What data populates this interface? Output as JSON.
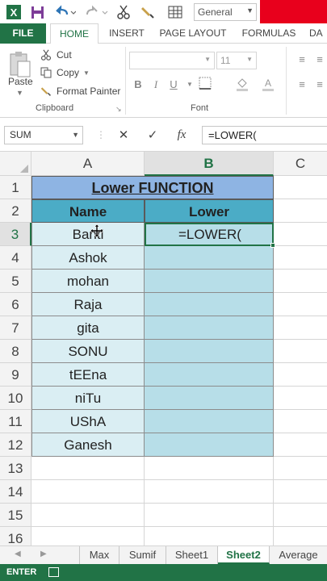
{
  "toolbar": {
    "number_format": "General",
    "icons": [
      "excel-logo-icon",
      "save-icon",
      "undo-icon",
      "redo-icon",
      "cut-icon",
      "format-painter-icon",
      "table-icon"
    ]
  },
  "ribbon": {
    "tabs": [
      {
        "label": "FILE"
      },
      {
        "label": "HOME"
      },
      {
        "label": "INSERT"
      },
      {
        "label": "PAGE LAYOUT"
      },
      {
        "label": "FORMULAS"
      },
      {
        "label": "DA"
      }
    ],
    "clipboard": {
      "paste": "Paste",
      "cut": "Cut",
      "copy": "Copy",
      "format_painter": "Format Painter",
      "group_label": "Clipboard"
    },
    "font": {
      "size": "11",
      "group_label": "Font"
    }
  },
  "formula_bar": {
    "name_box": "SUM",
    "fx_label": "fx",
    "formula": "=LOWER("
  },
  "grid": {
    "columns": [
      "A",
      "B",
      "C"
    ],
    "rows": [
      "1",
      "2",
      "3",
      "4",
      "5",
      "6",
      "7",
      "8",
      "9",
      "10",
      "11",
      "12",
      "13",
      "14",
      "15",
      "16"
    ],
    "title": "Lower FUNCTION",
    "headers": [
      "Name",
      "Lower"
    ],
    "names": [
      "Banti",
      "Ashok",
      "mohan",
      "Raja",
      "gita",
      "SONU",
      "tEEna",
      "niTu",
      "UShA",
      "Ganesh"
    ],
    "active_cell_value": "=LOWER("
  },
  "sheets": {
    "tabs": [
      "Max",
      "Sumif",
      "Sheet1",
      "Sheet2",
      "Average"
    ],
    "active": "Sheet2"
  },
  "status": {
    "mode": "ENTER"
  },
  "colors": {
    "excel_green": "#217346",
    "title_fill": "#8eb4e3",
    "header_fill": "#4bacc6",
    "name_fill": "#daeef3",
    "lower_fill": "#b7dee8"
  }
}
